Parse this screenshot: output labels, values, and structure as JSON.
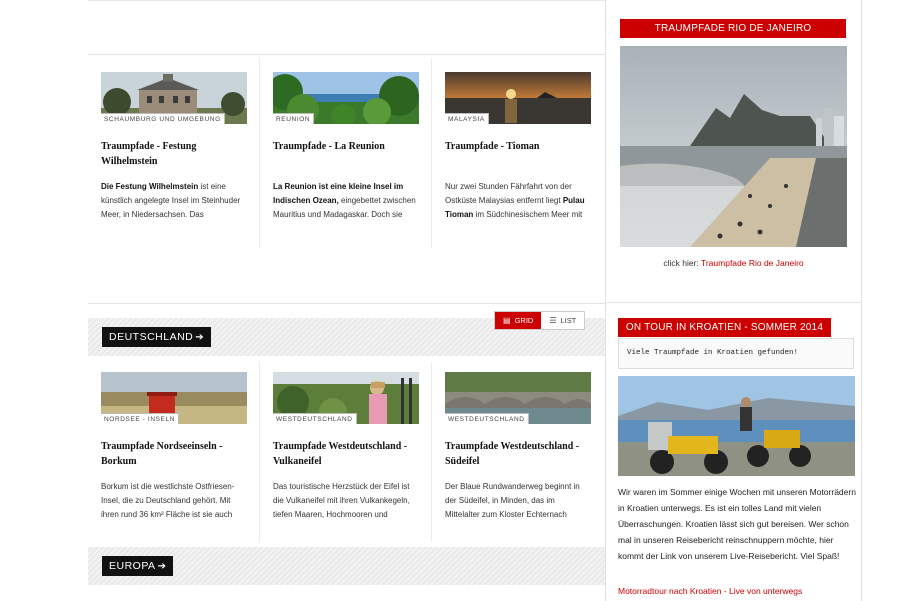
{
  "section1": {
    "cards": [
      {
        "tag": "SCHAUMBURG UND UMGEBUNG",
        "title": "Traumpfade - Festung Wilhelmstein",
        "text_bold": "Die Festung Wilhelmstein",
        "text_rest": " ist eine künstlich angelegte Insel im Steinhuder Meer, in Niedersachsen. Das"
      },
      {
        "tag": "REUNION",
        "title": "Traumpfade - La Reunion",
        "text_bold": "La Reunion ist eine kleine Insel  im Indischen Ozean,",
        "text_rest": " eingebettet zwischen Mauritius und Madagaskar. Doch sie"
      },
      {
        "tag": "MALAYSIA",
        "title": "Traumpfade - Tioman",
        "text_pre": "Nur zwei Stunden Fährfahrt von der Ostküste Malaysias entfernt liegt ",
        "text_bold": "Pulau Tioman",
        "text_rest": " im Südchinesischem Meer mit"
      }
    ]
  },
  "deutschland": {
    "label": "DEUTSCHLAND",
    "arrow": "➔",
    "view_grid": "GRID",
    "view_list": "LIST",
    "cards": [
      {
        "tag": "NORDSEE - INSELN",
        "title": "Traumpfade Nordseeinseln - Borkum",
        "text": "Borkum ist die westlichste Ostfriesen-Insel, die zu Deutschland gehört. Mit ihren rund 36 km² Fläche ist sie auch"
      },
      {
        "tag": "WESTDEUTSCHLAND",
        "title": "Traumpfade Westdeutschland - Vulkaneifel",
        "text": "Das touristische Herzstück der Eifel ist die Vulkaneifel mit ihren Vulkankegeln, tiefen Maaren, Hochmooren und"
      },
      {
        "tag": "WESTDEUTSCHLAND",
        "title": "Traumpfade Westdeutschland - Südeifel",
        "text": "Der Blaue Rundwanderweg  beginnt in der Südeifel, in Minden, das im Mittelalter zum Kloster Echternach"
      }
    ]
  },
  "europa": {
    "label": "EUROPA",
    "arrow": "➔"
  },
  "sidebar": {
    "rio": {
      "heading": "TRAUMPFADE RIO DE JANEIRO",
      "click_prefix": "click hier: ",
      "click_link": "Traumpfade Rio de Janeiro"
    },
    "kroatien": {
      "heading": "ON TOUR IN KROATIEN - SOMMER 2014",
      "notice": "Viele Traumpfade in Kroatien gefunden!",
      "text": "Wir waren im Sommer einige Wochen mit unseren Motorrädern in Kroatien unterwegs. Es ist ein tolles Land mit vielen Überraschungen. Kroatien lässt sich gut bereisen. Wer schon mal in unseren Reisebericht reinschnuppern möchte, hier kommt der Link von unserem Live-Reisebericht. Viel Spaß!",
      "link": "Motorradtour nach Kroatien - Live von unterwegs"
    }
  },
  "colors": {
    "accent": "#cc0000",
    "dark": "#111111"
  }
}
